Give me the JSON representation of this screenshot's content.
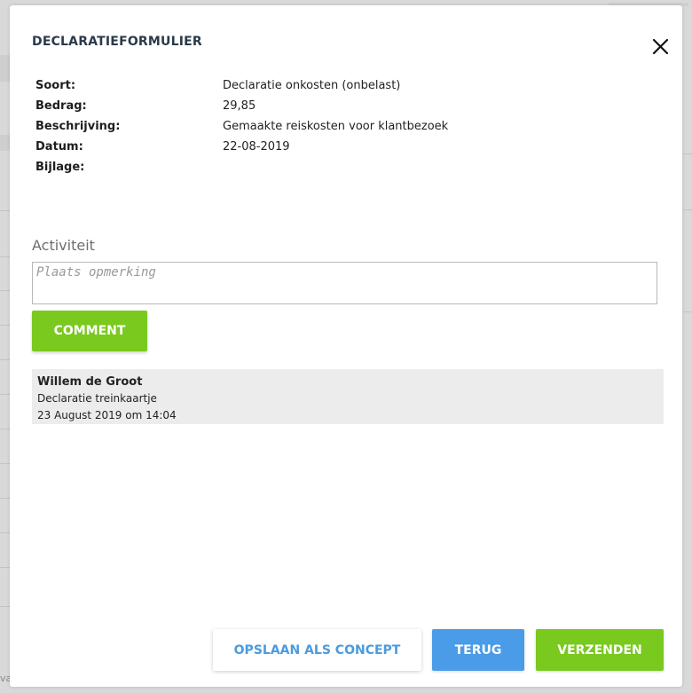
{
  "background": {
    "fragments": [
      "va"
    ]
  },
  "modal": {
    "title": "DECLARATIEFORMULIER",
    "close_icon": "close-icon",
    "details": [
      {
        "label": "Soort:",
        "value": "Declaratie onkosten (onbelast)"
      },
      {
        "label": "Bedrag:",
        "value": "29,85"
      },
      {
        "label": "Beschrijving:",
        "value": "Gemaakte reiskosten voor klantbezoek"
      },
      {
        "label": "Datum:",
        "value": "22-08-2019"
      },
      {
        "label": "Bijlage:",
        "value": ""
      }
    ],
    "activity": {
      "title": "Activiteit",
      "comment_placeholder": "Plaats opmerking",
      "comment_value": "",
      "comment_button": "COMMENT",
      "items": [
        {
          "author": "Willem de Groot",
          "text": "Declaratie treinkaartje",
          "timestamp": "23 August 2019 om 14:04"
        }
      ]
    },
    "footer": {
      "save_concept": "OPSLAAN ALS CONCEPT",
      "back": "TERUG",
      "send": "VERZENDEN"
    }
  },
  "colors": {
    "accent_green": "#7ac91e",
    "accent_blue": "#4a9be8",
    "title_color": "#2b3a4a"
  }
}
